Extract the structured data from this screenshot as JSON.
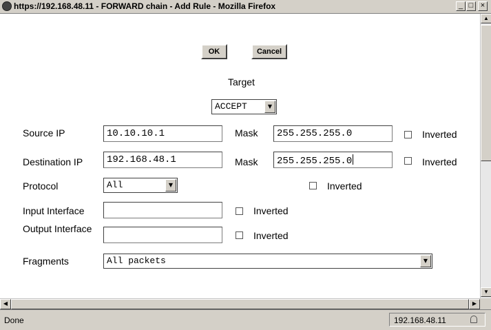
{
  "window": {
    "title": "https://192.168.48.11 - FORWARD chain - Add Rule - Mozilla Firefox",
    "minimize": "_",
    "maximize": "□",
    "close": "×"
  },
  "form": {
    "ok_label": "OK",
    "cancel_label": "Cancel",
    "target_label": "Target",
    "target_value": "ACCEPT",
    "source_ip_label": "Source IP",
    "source_ip_value": "10.10.10.1",
    "source_mask_label": "Mask",
    "source_mask_value": "255.255.255.0",
    "source_inverted_label": "Inverted",
    "dest_ip_label": "Destination IP",
    "dest_ip_value": "192.168.48.1",
    "dest_mask_label": "Mask",
    "dest_mask_value": "255.255.255.0",
    "dest_inverted_label": "Inverted",
    "protocol_label": "Protocol",
    "protocol_value": "All",
    "protocol_inverted_label": "Inverted",
    "input_interface_label": "Input Interface",
    "input_interface_value": "",
    "input_inverted_label": "Inverted",
    "output_interface_label": "Output Interface",
    "output_interface_value": "",
    "output_inverted_label": "Inverted",
    "fragments_label": "Fragments",
    "fragments_value": "All packets"
  },
  "status": {
    "text": "Done",
    "host": "192.168.48.11"
  },
  "icons": {
    "dropdown": "▼",
    "scroll_up": "▲",
    "scroll_down": "▼",
    "scroll_left": "◀",
    "scroll_right": "▶"
  }
}
